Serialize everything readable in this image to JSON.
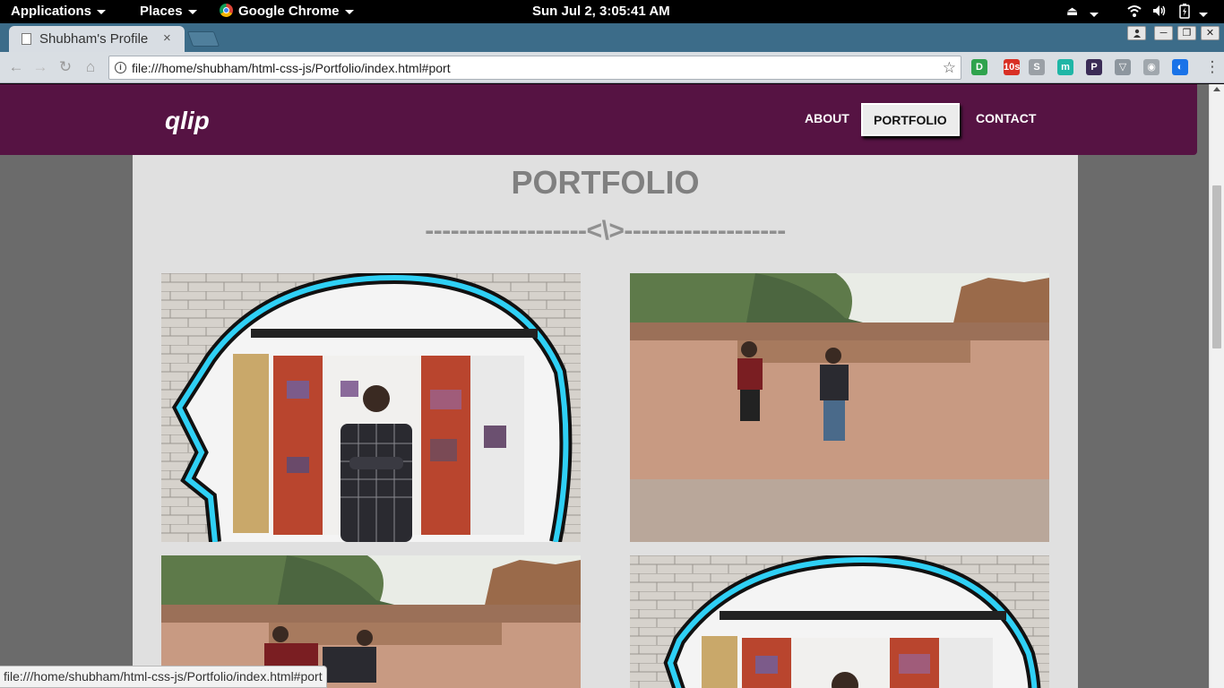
{
  "desktop_panel": {
    "applications_label": "Applications",
    "places_label": "Places",
    "active_app_label": "Google Chrome",
    "clock": "Sun Jul  2,  3:05:41 AM"
  },
  "browser": {
    "tab_title": "Shubham's Profile",
    "tab_close": "×",
    "url": "file:///home/shubham/html-css-js/Portfolio/index.html#port",
    "status_url": "file:///home/shubham/html-css-js/Portfolio/index.html#port",
    "extensions": [
      {
        "name": "pocket-extension-icon",
        "label": "D",
        "color": "#2fa34d"
      },
      {
        "name": "mail-extension-icon",
        "label": "10s",
        "color": "#d93025"
      },
      {
        "name": "session-extension-icon",
        "label": "S",
        "color": "#9aa0a6"
      },
      {
        "name": "momentum-extension-icon",
        "label": "m",
        "color": "#1fb6a6"
      },
      {
        "name": "pushbullet-extension-icon",
        "label": "P",
        "color": "#3b2c56"
      },
      {
        "name": "vpn-extension-icon",
        "label": "▽",
        "color": "#8d969e"
      },
      {
        "name": "profile-extension-icon",
        "label": "◉",
        "color": "#a0a7ad"
      },
      {
        "name": "sync-extension-icon",
        "label": "◐",
        "color": "#1a73e8"
      }
    ]
  },
  "site": {
    "brand": "qlip",
    "nav": {
      "about": "ABOUT",
      "portfolio": "PORTFOLIO",
      "contact": "CONTACT"
    },
    "portfolio": {
      "heading": "PORTFOLIO",
      "divider": "-------------------<\\>-------------------"
    }
  }
}
